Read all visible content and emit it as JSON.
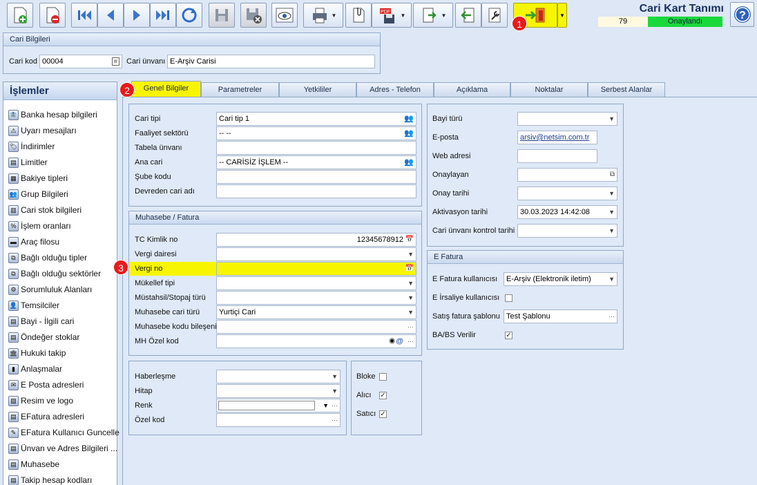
{
  "header": {
    "title": "Cari Kart Tanımı",
    "record_no": "79",
    "status": "Onaylandı"
  },
  "toolbar": {
    "buttons": [
      {
        "icon": "new-doc-icon"
      },
      {
        "icon": "delete-doc-icon"
      },
      {
        "icon": "first-icon"
      },
      {
        "icon": "prev-icon"
      },
      {
        "icon": "next-icon"
      },
      {
        "icon": "last-icon"
      },
      {
        "icon": "refresh-icon"
      },
      {
        "icon": "save-icon"
      },
      {
        "icon": "save-cancel-icon"
      },
      {
        "icon": "preview-icon"
      },
      {
        "icon": "print-icon"
      },
      {
        "icon": "attach-icon"
      },
      {
        "icon": "pdf-icon"
      },
      {
        "icon": "export-icon"
      },
      {
        "icon": "back-icon"
      },
      {
        "icon": "tools-icon"
      },
      {
        "icon": "door-exit-icon"
      }
    ],
    "help_icon": "help-icon"
  },
  "cari_bilgileri": {
    "title": "Cari Bilgileri",
    "kod_label": "Cari kod",
    "kod_value": "00004",
    "kod_btn": "#",
    "unvan_label": "Cari ünvanı",
    "unvan_value": "E-Arşiv Carisi"
  },
  "sidebar": {
    "title": "İşlemler",
    "items": [
      "Banka hesap bilgileri",
      "Uyarı mesajları",
      "İndirimler",
      "Limitler",
      "Bakiye tipleri",
      "Grup Bilgileri",
      "Cari stok bilgileri",
      "İşlem oranları",
      "Araç filosu",
      "Bağlı olduğu tipler",
      "Bağlı olduğu sektörler",
      "Sorumluluk Alanları",
      "Temsilciler",
      "Bayi - İlgili cari",
      "Öndeğer stoklar",
      "Hukuki takip",
      "Anlaşmalar",
      "E Posta adresleri",
      "Resim ve logo",
      "EFatura adresleri",
      "EFatura Kullanıcı Guncelle",
      "Ünvan ve Adres Bilgileri ...",
      "Muhasebe",
      "Takip hesap kodları"
    ]
  },
  "tabs": [
    "Genel Bilgiler",
    "Parametreler",
    "Yetkililer",
    "Adres - Telefon",
    "Açıklama",
    "Noktalar",
    "Serbest Alanlar"
  ],
  "genel": {
    "cari_tipi": {
      "label": "Cari tipi",
      "value": "Cari tip 1"
    },
    "faaliyet": {
      "label": "Faaliyet sektörü",
      "value": "-- --"
    },
    "tabela": {
      "label": "Tabela ünvanı",
      "value": ""
    },
    "ana_cari": {
      "label": "Ana cari",
      "value": "-- CARİSİZ İŞLEM --"
    },
    "sube": {
      "label": "Şube kodu",
      "value": ""
    },
    "devreden": {
      "label": "Devreden cari adı",
      "value": ""
    }
  },
  "muhasebe": {
    "title": "Muhasebe / Fatura",
    "tc": {
      "label": "TC Kimlik no",
      "value": "12345678912"
    },
    "vergi_dairesi": {
      "label": "Vergi dairesi",
      "value": ""
    },
    "vergi_no": {
      "label": "Vergi no",
      "value": ""
    },
    "mukellef": {
      "label": "Mükellef tipi",
      "value": ""
    },
    "mustahsil": {
      "label": "Müstahsil/Stopaj türü",
      "value": ""
    },
    "muh_cari_turu": {
      "label": "Muhasebe cari türü",
      "value": "Yurtiçi Cari"
    },
    "muh_kodu": {
      "label": "Muhasebe kodu bileşeni",
      "value": ""
    },
    "mh_ozel": {
      "label": "MH Özel kod",
      "value": ""
    }
  },
  "diger": {
    "haberlesme": "Haberleşme",
    "hitap": "Hitap",
    "renk": "Renk",
    "ozel_kod": "Özel kod",
    "ellipsis": "···"
  },
  "flags": {
    "bloke": {
      "label": "Bloke",
      "checked": false
    },
    "alici": {
      "label": "Alıcı",
      "checked": true
    },
    "satici": {
      "label": "Satıcı",
      "checked": true
    }
  },
  "right": {
    "bayi_turu": {
      "label": "Bayi türü",
      "value": ""
    },
    "eposta": {
      "label": "E-posta",
      "value": "arsiv@netsim.com.tr"
    },
    "web": {
      "label": "Web adresi",
      "value": ""
    },
    "onaylayan": {
      "label": "Onaylayan",
      "value": ""
    },
    "onay_tarihi": {
      "label": "Onay tarihi",
      "value": ""
    },
    "aktivasyon": {
      "label": "Aktivasyon tarihi",
      "value": "30.03.2023 14:42:08"
    },
    "unvan_kontrol": {
      "label": "Cari ünvanı kontrol tarihi",
      "value": ""
    }
  },
  "efatura": {
    "title": "E Fatura",
    "kullanici": {
      "label": "E Fatura kullanıcısı",
      "value": "E-Arşiv (Elektronik iletim)"
    },
    "irsaliye": {
      "label": "E İrsaliye kullanıcısı",
      "checked": false
    },
    "sablon": {
      "label": "Satış fatura şablonu",
      "value": "Test Şablonu"
    },
    "babs": {
      "label": "BA/BS Verilir",
      "checked": true
    }
  },
  "markers": [
    "1",
    "2",
    "3"
  ],
  "colors": {
    "highlight": "#f7f600",
    "status_green": "#19d83c",
    "marker_red": "#e81a1a"
  }
}
